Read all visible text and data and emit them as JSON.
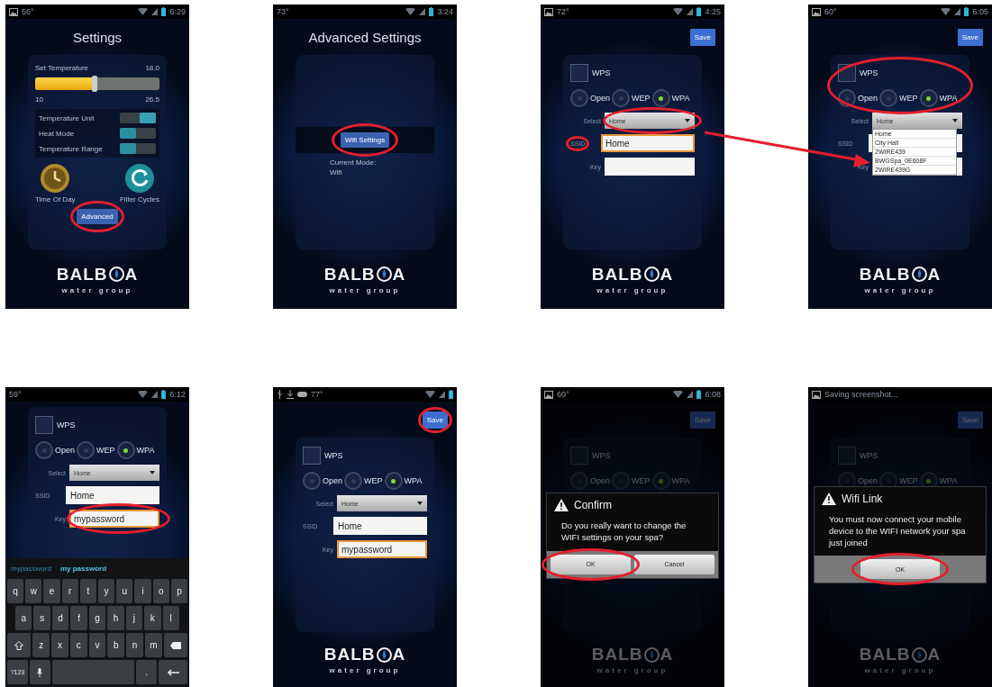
{
  "screens": [
    {
      "kind": "settings",
      "status": {
        "icons": [
          {
            "kind": "photo"
          }
        ],
        "temp": "56°",
        "time": "6:29",
        "signal": true
      },
      "title": "Settings",
      "slider": {
        "label": "Set Temperature",
        "value": "18.0",
        "level": 0.48,
        "min": "10",
        "max": "26.5"
      },
      "toggles": [
        {
          "label": "Temperature Unit",
          "on": true
        },
        {
          "label": "Heat Mode",
          "on": false
        },
        {
          "label": "Temperature Range",
          "on": false
        }
      ],
      "shortcuts": [
        {
          "kind": "clock",
          "label": "Time Of Day"
        },
        {
          "kind": "cycle",
          "label": "Filter Cycles"
        }
      ],
      "button": {
        "label": "Advanced",
        "circled": true
      },
      "logo": {
        "start": "BALB",
        "end": "A",
        "tagline": "water group"
      }
    },
    {
      "kind": "advanced",
      "status": {
        "temp": "73°",
        "time": "3:24",
        "signal": true
      },
      "title": "Advanced Settings",
      "button": {
        "label": "Wifi Settings",
        "circled": true
      },
      "mode_label": "Current Mode:",
      "mode_value": "Wifi",
      "logo": {
        "start": "BALB",
        "end": "A",
        "tagline": "water group"
      }
    },
    {
      "kind": "wifi",
      "status": {
        "icons": [
          {
            "kind": "photo"
          }
        ],
        "temp": "72°",
        "time": "4:25",
        "signal": true
      },
      "save": {
        "label": "Save",
        "circled": false
      },
      "form": {
        "options_circled": false,
        "wps": {
          "label": "WPS",
          "checked": false
        },
        "security": [
          {
            "label": "Open",
            "selected": false
          },
          {
            "label": "WEP",
            "selected": false
          },
          {
            "label": "WPA",
            "selected": true
          }
        ],
        "select": {
          "label": "Select",
          "value": "Home",
          "circled": true
        },
        "ssid": {
          "label": "SSID",
          "value": "Home",
          "focused": true,
          "label_circled": true
        },
        "key": {
          "label": "Key",
          "focused": false,
          "circled": false
        }
      },
      "logo": {
        "start": "BALB",
        "end": "A",
        "tagline": "water group"
      }
    },
    {
      "kind": "wifi",
      "status": {
        "icons": [
          {
            "kind": "photo"
          }
        ],
        "temp": "60°",
        "time": "6:05",
        "signal": true
      },
      "save": {
        "label": "Save",
        "circled": false
      },
      "form": {
        "options_circled": true,
        "wps": {
          "label": "WPS",
          "checked": false
        },
        "security": [
          {
            "label": "Open",
            "selected": false
          },
          {
            "label": "WEP",
            "selected": false
          },
          {
            "label": "WPA",
            "selected": true
          }
        ],
        "select": {
          "label": "Select",
          "value": "Home",
          "circled": false,
          "options": [
            "Home",
            "City Hall",
            "2WIRE439",
            "BWGSpa_0E608F",
            "2WIRE439G"
          ]
        },
        "ssid": {
          "label": "SSID",
          "focused": false,
          "label_circled": false
        },
        "key": {
          "label": "Key",
          "focused": false,
          "circled": false
        }
      },
      "logo": {
        "start": "BALB",
        "end": "A",
        "tagline": "water group"
      }
    },
    {
      "kind": "wifi",
      "status": {
        "temp": "59°",
        "time": "6:12",
        "signal": true
      },
      "form": {
        "options_circled": false,
        "wps": {
          "label": "WPS",
          "checked": false
        },
        "security": [
          {
            "label": "Open",
            "selected": false
          },
          {
            "label": "WEP",
            "selected": false
          },
          {
            "label": "WPA",
            "selected": true
          }
        ],
        "select": {
          "label": "Select",
          "value": "Home",
          "circled": false
        },
        "ssid": {
          "label": "SSID",
          "value": "Home",
          "focused": false,
          "label_circled": false
        },
        "key": {
          "label": "Key",
          "value": "mypassword",
          "focused": true,
          "circled": true
        }
      },
      "keyboard": {
        "suggestions": [
          {
            "label": "mypassword",
            "selected": false
          },
          {
            "label": "my password",
            "selected": true
          }
        ],
        "rows": [
          [
            {
              "kind": "text",
              "label": "q"
            },
            {
              "kind": "text",
              "label": "w"
            },
            {
              "kind": "text",
              "label": "e"
            },
            {
              "kind": "text",
              "label": "r"
            },
            {
              "kind": "text",
              "label": "t"
            },
            {
              "kind": "text",
              "label": "y"
            },
            {
              "kind": "text",
              "label": "u"
            },
            {
              "kind": "text",
              "label": "i"
            },
            {
              "kind": "text",
              "label": "o"
            },
            {
              "kind": "text",
              "label": "p"
            }
          ],
          [
            {
              "kind": "text",
              "label": "a"
            },
            {
              "kind": "text",
              "label": "s"
            },
            {
              "kind": "text",
              "label": "d"
            },
            {
              "kind": "text",
              "label": "f"
            },
            {
              "kind": "text",
              "label": "g"
            },
            {
              "kind": "text",
              "label": "h"
            },
            {
              "kind": "text",
              "label": "j"
            },
            {
              "kind": "text",
              "label": "k"
            },
            {
              "kind": "text",
              "label": "l"
            }
          ],
          [
            {
              "kind": "shift"
            },
            {
              "kind": "text",
              "label": "z"
            },
            {
              "kind": "text",
              "label": "x"
            },
            {
              "kind": "text",
              "label": "c"
            },
            {
              "kind": "text",
              "label": "v"
            },
            {
              "kind": "text",
              "label": "b"
            },
            {
              "kind": "text",
              "label": "n"
            },
            {
              "kind": "text",
              "label": "m"
            },
            {
              "kind": "backspace"
            }
          ],
          [
            {
              "kind": "text",
              "label": "?123"
            },
            {
              "kind": "mic"
            },
            {
              "kind": "space"
            },
            {
              "kind": "text",
              "label": "."
            },
            {
              "kind": "enter"
            }
          ]
        ]
      }
    },
    {
      "kind": "wifi",
      "status": {
        "icons": [
          {
            "kind": "usb"
          },
          {
            "kind": "download"
          },
          {
            "kind": "controller"
          }
        ],
        "temp": "77°",
        "signal": true
      },
      "save": {
        "label": "Save",
        "circled": true
      },
      "form": {
        "options_circled": false,
        "wps": {
          "label": "WPS",
          "checked": false
        },
        "security": [
          {
            "label": "Open",
            "selected": false
          },
          {
            "label": "WEP",
            "selected": false
          },
          {
            "label": "WPA",
            "selected": true
          }
        ],
        "select": {
          "label": "Select",
          "value": "Home",
          "circled": false
        },
        "ssid": {
          "label": "SSID",
          "value": "Home",
          "focused": false,
          "label_circled": false
        },
        "key": {
          "label": "Key",
          "value": "mypassword",
          "focused": true,
          "circled": false
        }
      },
      "logo": {
        "start": "BALB",
        "end": "A",
        "tagline": "water group"
      }
    },
    {
      "kind": "wifi",
      "status": {
        "icons": [
          {
            "kind": "photo"
          }
        ],
        "temp": "60°",
        "time": "6:08",
        "signal": true
      },
      "save": {
        "label": "Save",
        "circled": false
      },
      "form": {
        "options_circled": false,
        "wps": {
          "label": "WPS",
          "checked": false
        },
        "security": [
          {
            "label": "Open",
            "selected": false
          },
          {
            "label": "WEP",
            "selected": false
          },
          {
            "label": "WPA",
            "selected": true
          }
        ]
      },
      "dialog": {
        "title": "Confirm",
        "message": "Do you really want to change the WIFI settings on your spa?",
        "buttons": [
          {
            "label": "OK",
            "circled": true
          },
          {
            "label": "Cancel",
            "circled": false
          }
        ]
      },
      "logo": {
        "start": "BALB",
        "end": "A",
        "tagline": "water group"
      }
    },
    {
      "kind": "wifi",
      "status": {
        "icons": [
          {
            "kind": "photo"
          }
        ],
        "message": "Saving screenshot...",
        "signal": false
      },
      "save": {
        "label": "Save",
        "circled": false
      },
      "form": {
        "options_circled": false,
        "wps": {
          "label": "WPS",
          "checked": false
        },
        "security": [
          {
            "label": "Open",
            "selected": false
          },
          {
            "label": "WEP",
            "selected": false
          },
          {
            "label": "WPA",
            "selected": true
          }
        ]
      },
      "dialog": {
        "title": "Wifi Link",
        "message": "You must now connect your mobile device to the WIFI network your spa just joined",
        "buttons": [
          {
            "label": "OK",
            "circled": true
          }
        ]
      },
      "logo": {
        "start": "BALB",
        "end": "A",
        "tagline": "water group"
      }
    }
  ]
}
